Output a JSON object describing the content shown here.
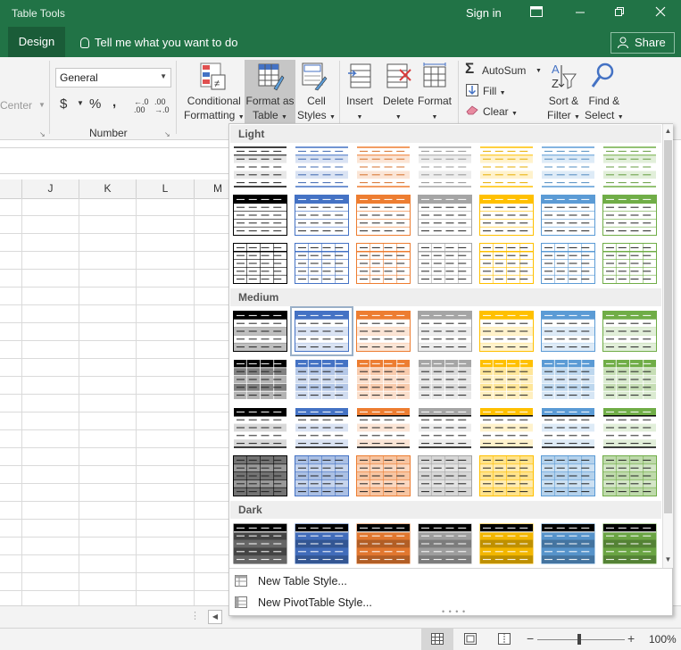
{
  "titlebar": {
    "context_title": "Table Tools",
    "signin": "Sign in",
    "color": "#217346"
  },
  "tabs": {
    "design": "Design",
    "tellme": "Tell me what you want to do",
    "share": "Share"
  },
  "ribbon": {
    "center_label": "Center",
    "number_format": "General",
    "currency": "$",
    "percent": "%",
    "comma": ",",
    "inc_decimal": "←.0\n.00",
    "number_group": "Number",
    "conditional": [
      "Conditional",
      "Formatting"
    ],
    "format_as_table": [
      "Format as",
      "Table"
    ],
    "cell_styles": [
      "Cell",
      "Styles"
    ],
    "insert": "Insert",
    "delete": "Delete",
    "format": "Format",
    "autosum": "AutoSum",
    "fill": "Fill",
    "clear": "Clear",
    "sort_filter": [
      "Sort &",
      "Filter"
    ],
    "find_select": [
      "Find &",
      "Select"
    ]
  },
  "columns": [
    "J",
    "K",
    "L",
    "M"
  ],
  "gallery": {
    "sections": [
      {
        "name": "Light",
        "rows": 3
      },
      {
        "name": "Medium",
        "rows": 4
      },
      {
        "name": "Dark",
        "rows": 1
      }
    ],
    "palette": [
      "#000000",
      "#4472c4",
      "#ed7d31",
      "#a5a5a5",
      "#ffc000",
      "#5b9bd5",
      "#70ad47"
    ],
    "selected": "Medium 2",
    "menu": [
      "New Table Style...",
      "New PivotTable Style..."
    ]
  },
  "status": {
    "zoom": "100%"
  }
}
